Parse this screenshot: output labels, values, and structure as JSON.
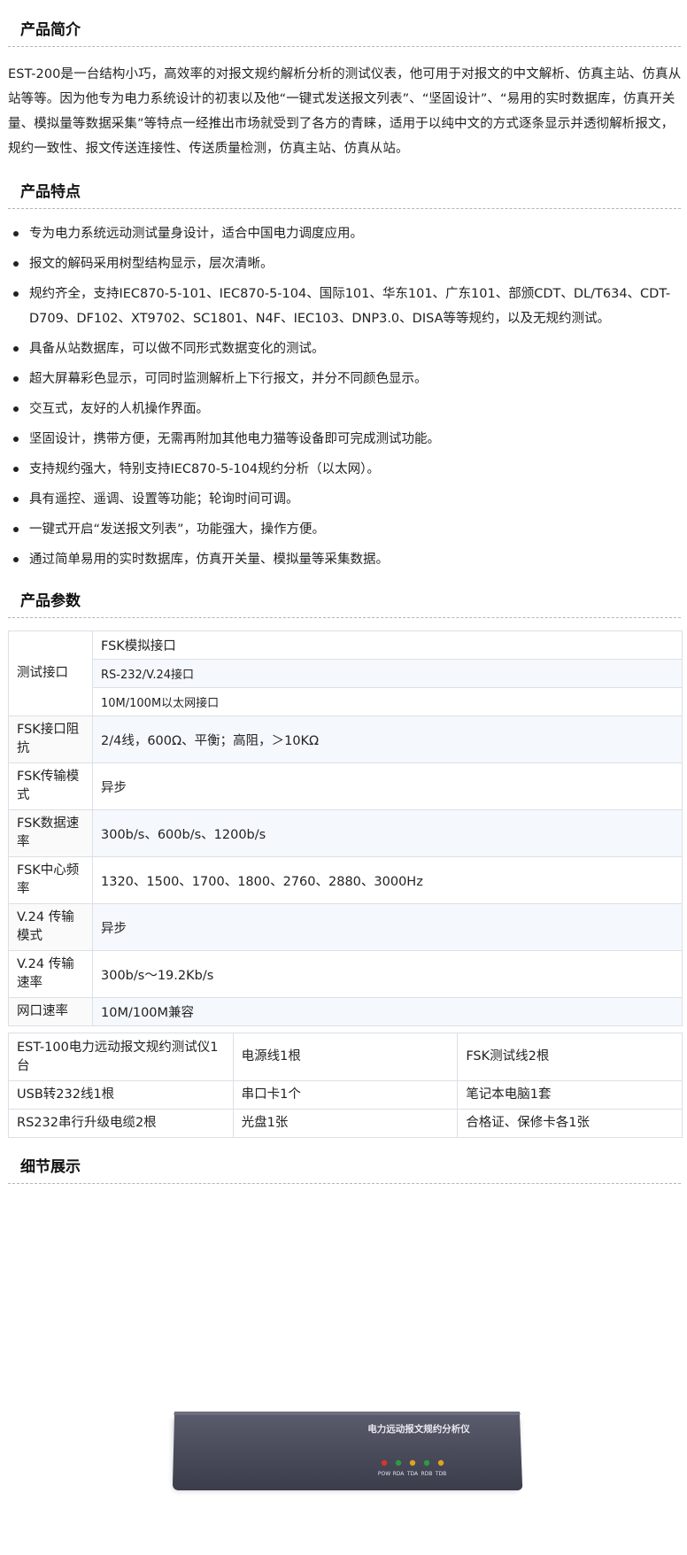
{
  "intro": {
    "title": "产品简介",
    "text": "EST-200是一台结构小巧，高效率的对报文规约解析分析的测试仪表，他可用于对报文的中文解析、仿真主站、仿真从站等等。因为他专为电力系统设计的初衷以及他“一键式发送报文列表”、“坚固设计”、“易用的实时数据库，仿真开关量、模拟量等数据采集”等特点一经推出市场就受到了各方的青睐，适用于以纯中文的方式逐条显示并透彻解析报文，规约一致性、报文传送连接性、传送质量检测，仿真主站、仿真从站。"
  },
  "features": {
    "title": "产品特点",
    "items": [
      "专为电力系统远动测试量身设计，适合中国电力调度应用。",
      "报文的解码采用树型结构显示，层次清晰。",
      "规约齐全，支持IEC870-5-101、IEC870-5-104、国际101、华东101、广东101、部颁CDT、DL/T634、CDT-D709、DF102、XT9702、SC1801、N4F、IEC103、DNP3.0、DISA等等规约，以及无规约测试。",
      "具备从站数据库，可以做不同形式数据变化的测试。",
      "超大屏幕彩色显示，可同时监测解析上下行报文，并分不同颜色显示。",
      "交互式，友好的人机操作界面。",
      "坚固设计，携带方便，无需再附加其他电力猫等设备即可完成测试功能。",
      "支持规约强大，特别支持IEC870-5-104规约分析（以太网）。",
      "具有遥控、遥调、设置等功能；轮询时间可调。",
      "一键式开启“发送报文列表”，功能强大，操作方便。",
      "通过简单易用的实时数据库，仿真开关量、模拟量等采集数据。"
    ]
  },
  "params": {
    "title": "产品参数",
    "interface_label": "测试接口",
    "interfaces": [
      "FSK模拟接口",
      "RS-232/V.24接口",
      "10M/100M以太网接口"
    ],
    "rows": [
      {
        "k": "FSK接口阻抗",
        "v": "2/4线，600Ω、平衡；高阻，＞10KΩ"
      },
      {
        "k": "FSK传输模式",
        "v": "异步"
      },
      {
        "k": "FSK数据速率",
        "v": "300b/s、600b/s、1200b/s"
      },
      {
        "k": "FSK中心频率",
        "v": "1320、1500、1700、1800、2760、2880、3000Hz"
      },
      {
        "k": "V.24 传输模式",
        "v": "异步"
      },
      {
        "k": "V.24 传输速率",
        "v": "300b/s～19.2Kb/s"
      },
      {
        "k": "网口速率",
        "v": "10M/100M兼容"
      }
    ]
  },
  "package": {
    "rows": [
      [
        "EST-100电力远动报文规约测试仪1台",
        "电源线1根",
        "FSK测试线2根"
      ],
      [
        "USB转232线1根",
        "串口卡1个",
        "笔记本电脑1套"
      ],
      [
        "RS232串行升级电缆2根",
        "光盘1张",
        "合格证、保修卡各1张"
      ]
    ]
  },
  "details": {
    "title": "细节展示",
    "device_label": "电力远动报文规约分析仪",
    "leds": [
      {
        "label": "POW",
        "color": "#d8352b"
      },
      {
        "label": "RDA",
        "color": "#2e9a43"
      },
      {
        "label": "TDA",
        "color": "#e0a21f"
      },
      {
        "label": "RDB",
        "color": "#2e9a43"
      },
      {
        "label": "TDB",
        "color": "#e0a21f"
      }
    ]
  }
}
